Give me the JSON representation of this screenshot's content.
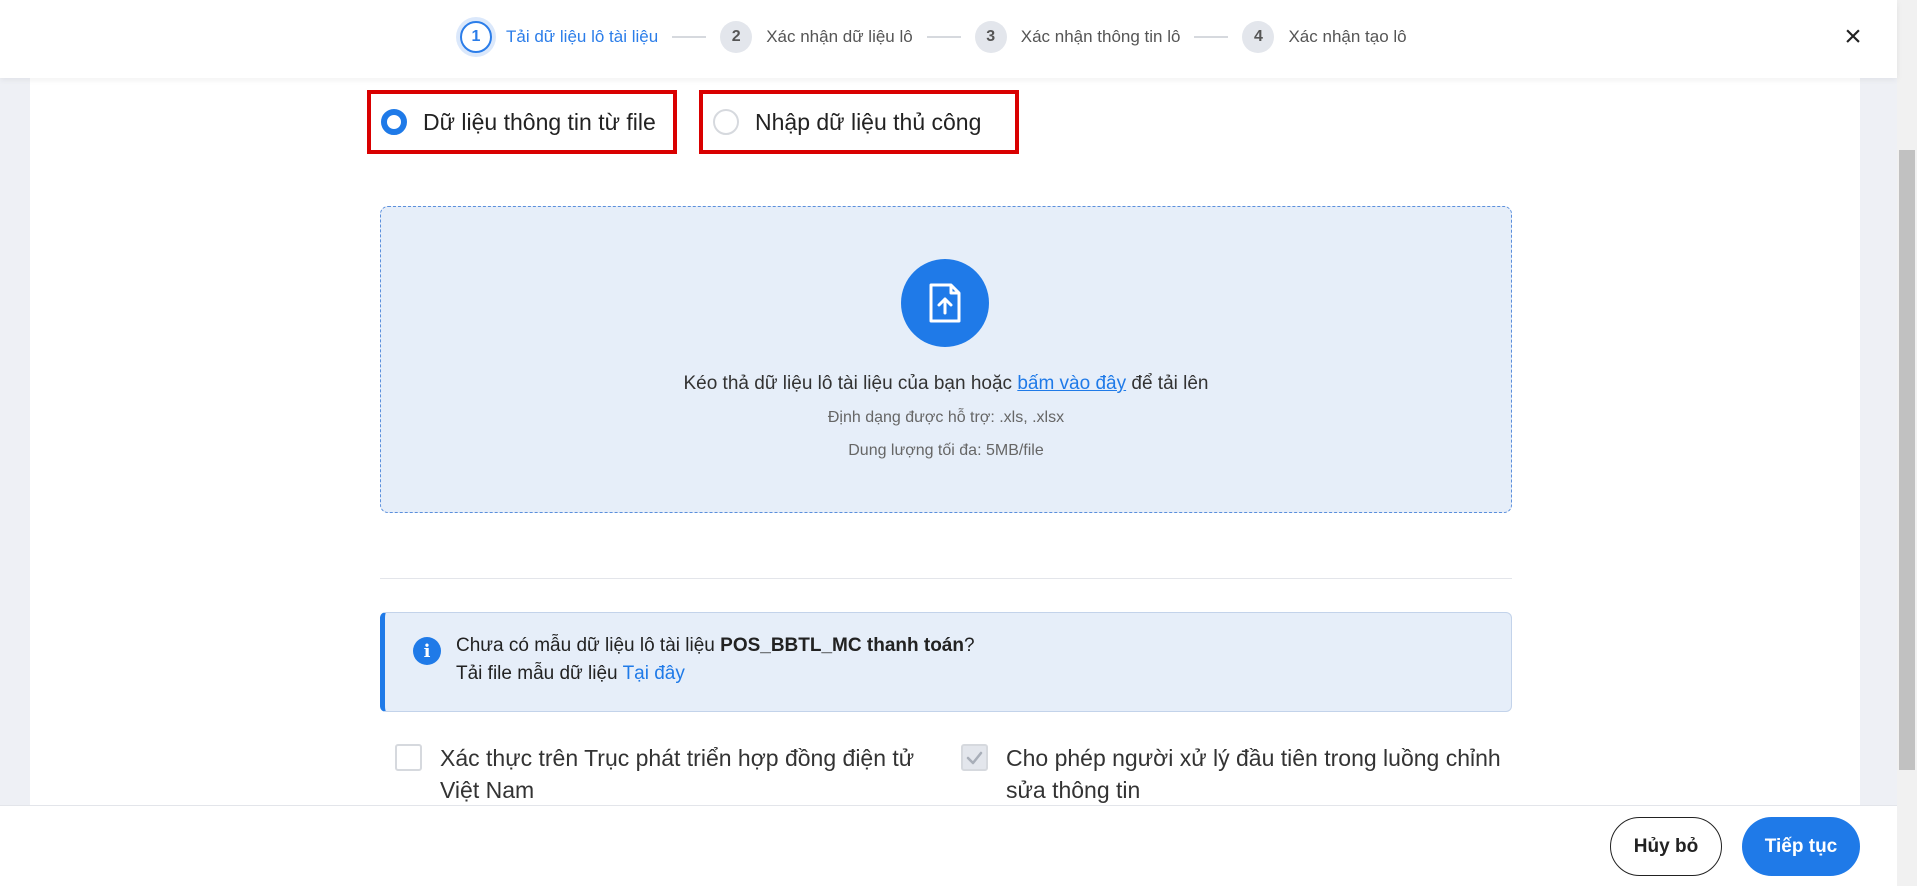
{
  "stepper": {
    "steps": [
      {
        "num": "1",
        "label": "Tải dữ liệu lô tài liệu"
      },
      {
        "num": "2",
        "label": "Xác nhận dữ liệu lô"
      },
      {
        "num": "3",
        "label": "Xác nhận thông tin lô"
      },
      {
        "num": "4",
        "label": "Xác nhận tạo lô"
      }
    ],
    "active_step": 1
  },
  "close_icon": "×",
  "source_options": {
    "file_label": "Dữ liệu thông tin từ file",
    "manual_label": "Nhập dữ liệu thủ công",
    "selected": "file"
  },
  "dropzone": {
    "text_before": "Kéo thả dữ liệu lô tài liệu của bạn hoặc ",
    "link_text": "bấm vào đây",
    "text_after": " để tải lên",
    "formats": "Định dạng được hỗ trợ: .xls, .xlsx",
    "max_size": "Dung lượng tối đa: 5MB/file",
    "icon": "file-upload-icon"
  },
  "info": {
    "line1_before": "Chưa có mẫu dữ liệu lô tài liệu ",
    "template_name": "POS_BBTL_MC thanh toán",
    "line1_after": "?",
    "line2_before": "Tải file mẫu dữ liệu ",
    "link_text": "Tại đây",
    "icon": "info-icon"
  },
  "options": {
    "verify_label": "Xác thực trên Trục phát triển hợp đồng điện tử Việt Nam",
    "verify_checked": false,
    "allow_edit_label": "Cho phép người xử lý đầu tiên trong luồng chỉnh sửa thông tin",
    "allow_edit_checked": true
  },
  "footer": {
    "cancel_label": "Hủy bỏ",
    "next_label": "Tiếp tục"
  },
  "colors": {
    "accent": "#1f7ae8",
    "highlight_border": "#d90000",
    "dropzone_bg": "#e6eef9"
  }
}
